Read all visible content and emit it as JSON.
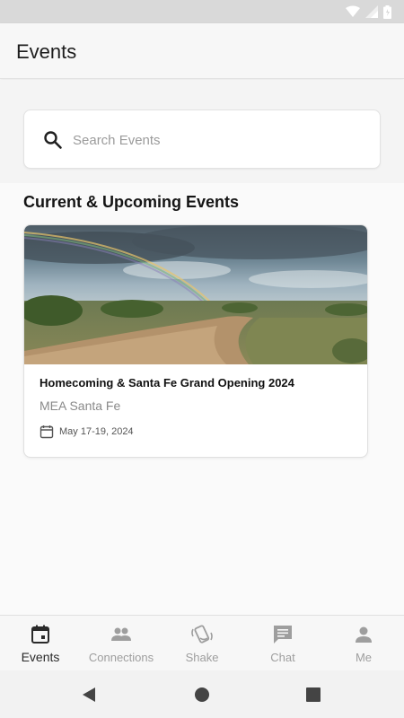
{
  "app": {
    "title": "Events"
  },
  "search": {
    "placeholder": "Search Events",
    "value": ""
  },
  "section": {
    "title": "Current & Upcoming Events"
  },
  "events": [
    {
      "title": "Homecoming & Santa Fe Grand Opening 2024",
      "location": "MEA Santa Fe",
      "date": "May 17-19, 2024",
      "image_icon": "landscape-rainbow-photo"
    }
  ],
  "nav": {
    "items": [
      {
        "label": "Events",
        "icon": "calendar-icon",
        "active": true
      },
      {
        "label": "Connections",
        "icon": "people-icon",
        "active": false
      },
      {
        "label": "Shake",
        "icon": "shake-phone-icon",
        "active": false
      },
      {
        "label": "Chat",
        "icon": "chat-icon",
        "active": false
      },
      {
        "label": "Me",
        "icon": "person-icon",
        "active": false
      }
    ]
  },
  "system_nav": {
    "back_icon": "back-triangle-icon",
    "home_icon": "home-circle-icon",
    "recents_icon": "recents-square-icon"
  },
  "colors": {
    "active": "#2a2a2a",
    "inactive": "#9e9e9e",
    "background": "#fafafa"
  }
}
